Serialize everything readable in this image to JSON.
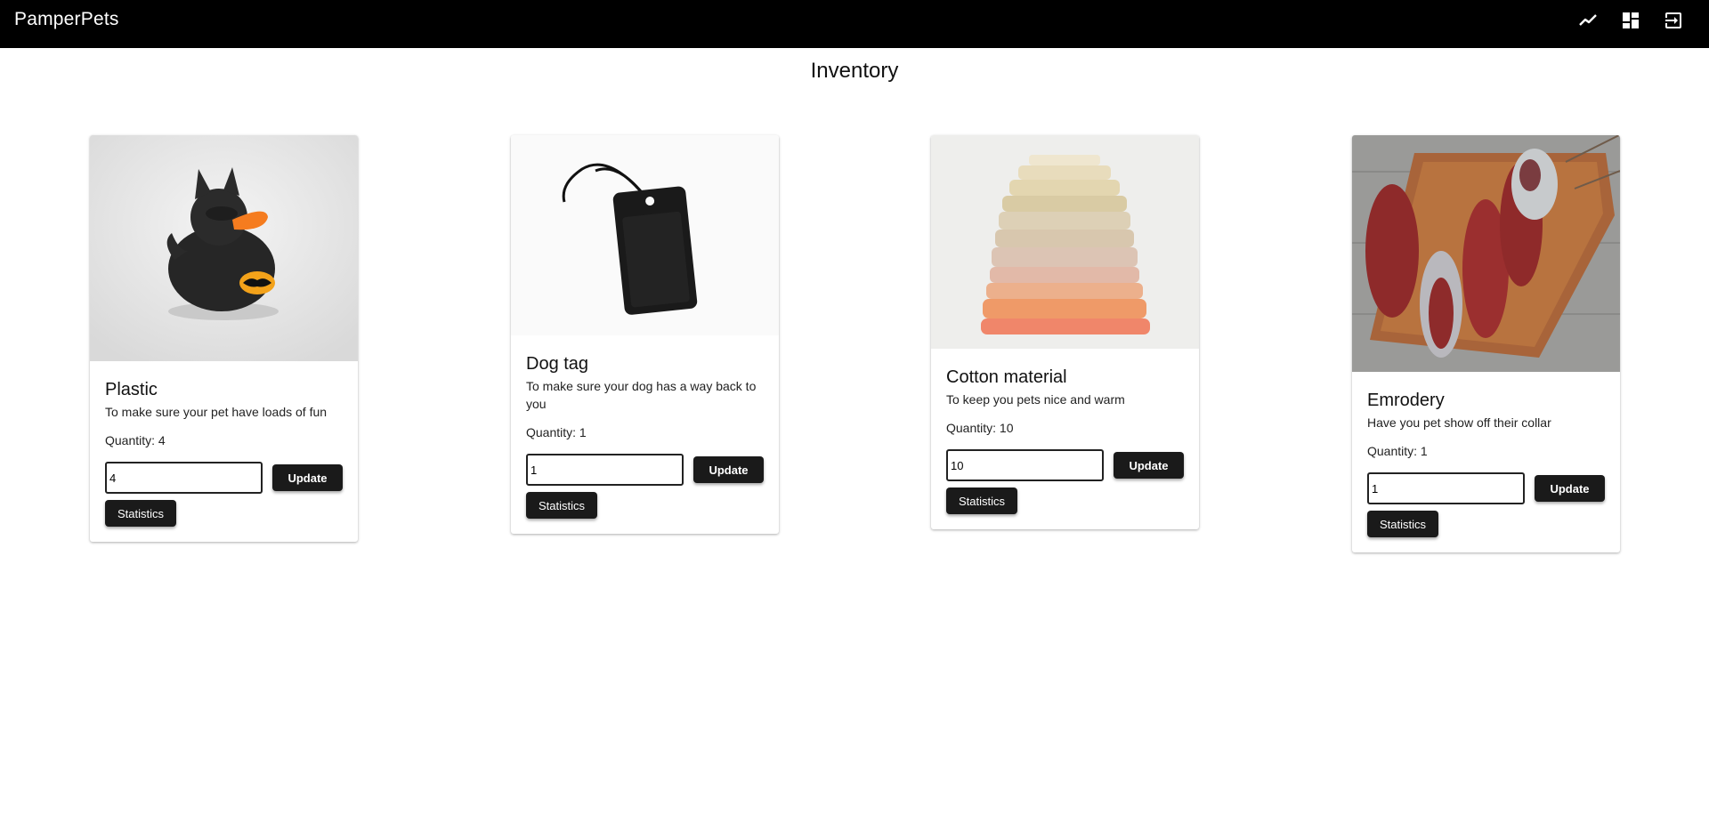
{
  "app": {
    "brand": "PamperPets"
  },
  "header": {
    "icons": [
      "chart-line-icon",
      "dashboard-icon",
      "logout-icon"
    ]
  },
  "page": {
    "title": "Inventory"
  },
  "buttons": {
    "update_label": "Update",
    "statistics_label": "Statistics"
  },
  "products": [
    {
      "name": "Plastic",
      "description": "To make sure your pet have loads of fun",
      "quantity_label": "Quantity: 4",
      "input_value": "4",
      "image": "batman-rubber-duck"
    },
    {
      "name": "Dog tag",
      "description": "To make sure your dog has a way back to you",
      "quantity_label": "Quantity: 1",
      "input_value": "1",
      "image": "black-dog-tag"
    },
    {
      "name": "Cotton material",
      "description": "To keep you pets nice and warm",
      "quantity_label": "Quantity: 10",
      "input_value": "10",
      "image": "stack-of-cotton-fabric"
    },
    {
      "name": "Emrodery",
      "description": "Have you pet show off their collar",
      "quantity_label": "Quantity: 1",
      "input_value": "1",
      "image": "yarn-skeins-on-board"
    }
  ]
}
